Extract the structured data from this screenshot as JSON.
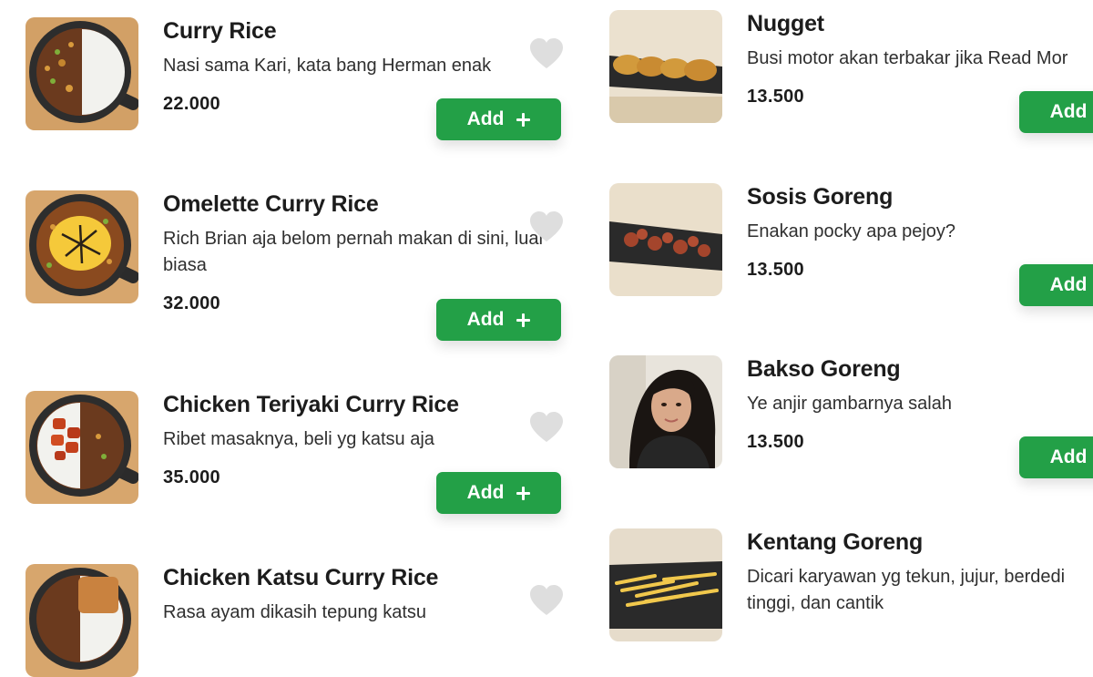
{
  "colors": {
    "accent": "#23a047",
    "heart": "#dedede"
  },
  "left_menu": [
    {
      "name": "Curry Rice",
      "description": "Nasi sama Kari, kata bang Herman enak",
      "price": "22.000",
      "add_label": "Add",
      "add_icon": "plus-icon",
      "favorite_icon": "heart-icon",
      "image": "curry-rice-photo"
    },
    {
      "name": "Omelette Curry Rice",
      "description": "Rich Brian aja belom pernah makan di sini, luar biasa",
      "price": "32.000",
      "add_label": "Add",
      "add_icon": "plus-icon",
      "favorite_icon": "heart-icon",
      "image": "omelette-curry-rice-photo"
    },
    {
      "name": "Chicken Teriyaki Curry Rice",
      "description": "Ribet masaknya, beli yg katsu aja",
      "price": "35.000",
      "add_label": "Add",
      "add_icon": "plus-icon",
      "favorite_icon": "heart-icon",
      "image": "chicken-teriyaki-curry-rice-photo"
    },
    {
      "name": "Chicken Katsu Curry Rice",
      "description": "Rasa ayam dikasih tepung katsu",
      "price": "",
      "add_label": "",
      "add_icon": "",
      "favorite_icon": "heart-icon",
      "image": "chicken-katsu-curry-rice-photo"
    }
  ],
  "right_menu": [
    {
      "name": "Nugget",
      "description": "Busi motor akan terbakar jika Read Mor",
      "price": "13.500",
      "add_label": "Add",
      "image": "nugget-photo"
    },
    {
      "name": "Sosis Goreng",
      "description": "Enakan pocky apa pejoy?",
      "price": "13.500",
      "add_label": "Add",
      "image": "sosis-goreng-photo"
    },
    {
      "name": "Bakso Goreng",
      "description": "Ye anjir gambarnya salah",
      "price": "13.500",
      "add_label": "Add",
      "image": "woman-selfie-photo"
    },
    {
      "name": "Kentang Goreng",
      "description": "Dicari karyawan yg tekun, jujur, berdedi tinggi, dan cantik",
      "price": "",
      "add_label": "",
      "image": "kentang-goreng-photo"
    }
  ]
}
